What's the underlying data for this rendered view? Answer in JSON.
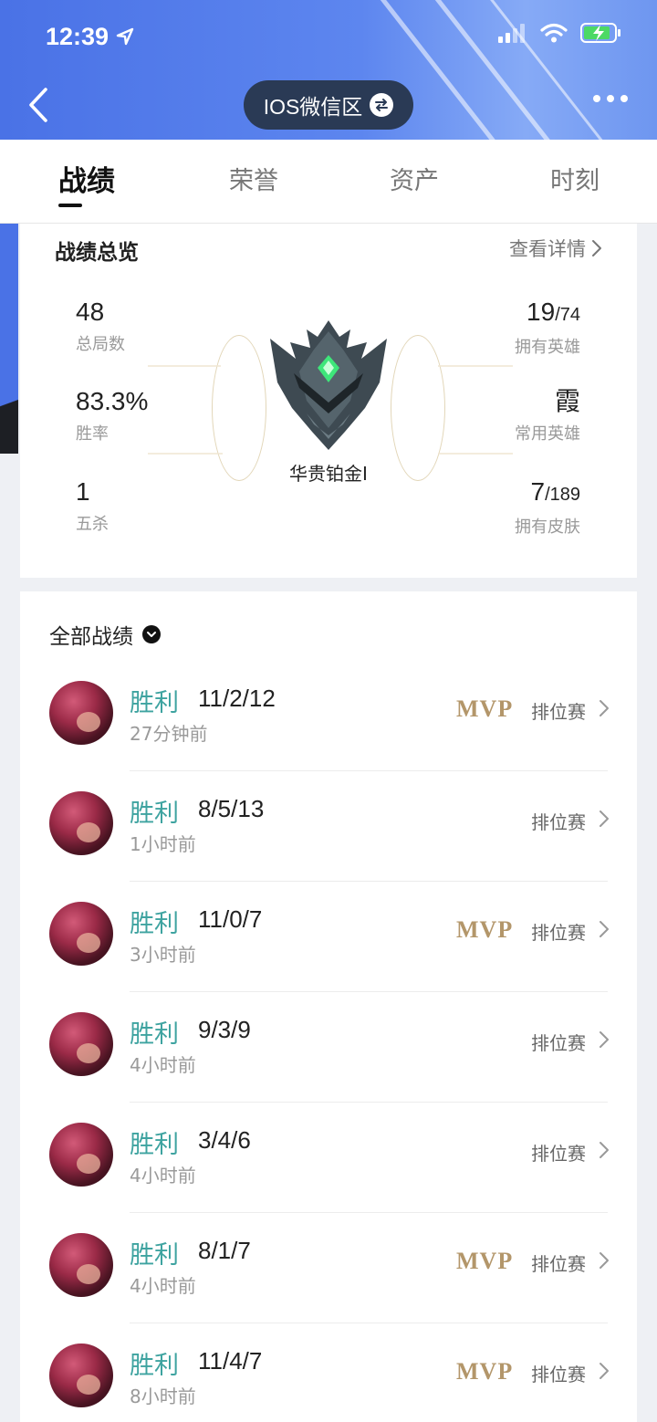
{
  "status_bar": {
    "time": "12:39"
  },
  "header": {
    "server": "IOS微信区"
  },
  "tabs": [
    {
      "label": "战绩",
      "active": true
    },
    {
      "label": "荣誉",
      "active": false
    },
    {
      "label": "资产",
      "active": false
    },
    {
      "label": "时刻",
      "active": false
    }
  ],
  "overview": {
    "title": "战绩总览",
    "detail_link": "查看详情",
    "total_games": {
      "value": "48",
      "label": "总局数"
    },
    "win_rate": {
      "value": "83.3%",
      "label": "胜率"
    },
    "pentakills": {
      "value": "1",
      "label": "五杀"
    },
    "heroes_owned": {
      "value": "19",
      "total": "/74",
      "label": "拥有英雄"
    },
    "common_hero": {
      "value": "霞",
      "label": "常用英雄"
    },
    "skins_owned": {
      "value": "7",
      "total": "/189",
      "label": "拥有皮肤"
    },
    "rank": "华贵铂金I"
  },
  "matches": {
    "title": "全部战绩",
    "items": [
      {
        "result": "胜利",
        "kda": "11/2/12",
        "time": "27分钟前",
        "mvp": "MVP",
        "mode": "排位赛"
      },
      {
        "result": "胜利",
        "kda": "8/5/13",
        "time": "1小时前",
        "mvp": "",
        "mode": "排位赛"
      },
      {
        "result": "胜利",
        "kda": "11/0/7",
        "time": "3小时前",
        "mvp": "MVP",
        "mode": "排位赛"
      },
      {
        "result": "胜利",
        "kda": "9/3/9",
        "time": "4小时前",
        "mvp": "",
        "mode": "排位赛"
      },
      {
        "result": "胜利",
        "kda": "3/4/6",
        "time": "4小时前",
        "mvp": "",
        "mode": "排位赛"
      },
      {
        "result": "胜利",
        "kda": "8/1/7",
        "time": "4小时前",
        "mvp": "MVP",
        "mode": "排位赛"
      },
      {
        "result": "胜利",
        "kda": "11/4/7",
        "time": "8小时前",
        "mvp": "MVP",
        "mode": "排位赛"
      }
    ]
  },
  "colors": {
    "header_blue": "#4a72e6",
    "win_green": "#3ea3a0",
    "mvp_gold": "#b3966a"
  }
}
